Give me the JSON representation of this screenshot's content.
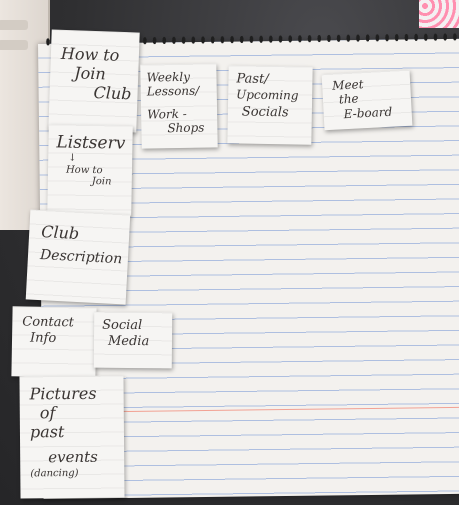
{
  "sticky_notes": [
    {
      "id": "how-to-join",
      "lines": [
        "How to",
        "Join",
        "Club"
      ]
    },
    {
      "id": "weekly-lessons",
      "lines": [
        "Weekly",
        "Lessons/",
        "Work -",
        "Shops"
      ]
    },
    {
      "id": "past-upcoming-socials",
      "lines": [
        "Past/",
        "Upcoming",
        "Socials"
      ]
    },
    {
      "id": "meet-the-eboard",
      "lines": [
        "Meet",
        "the",
        "E-board"
      ]
    },
    {
      "id": "listserv",
      "lines": [
        "Listserv",
        "↓",
        "How to",
        "Join"
      ]
    },
    {
      "id": "club-description",
      "lines": [
        "Club",
        "Description"
      ]
    },
    {
      "id": "contact-info",
      "lines": [
        "Contact",
        "Info"
      ]
    },
    {
      "id": "social-media",
      "lines": [
        "Social",
        "Media"
      ]
    },
    {
      "id": "pictures-past-events",
      "lines": [
        "Pictures",
        "of",
        "past",
        "events",
        "(dancing)"
      ]
    }
  ],
  "colors": {
    "note_paper": "#f6f5f3",
    "ink": "#3a3533",
    "ruled_line": "#aebfe0",
    "margin_line": "#f2a193",
    "background": "#2f2f31"
  }
}
